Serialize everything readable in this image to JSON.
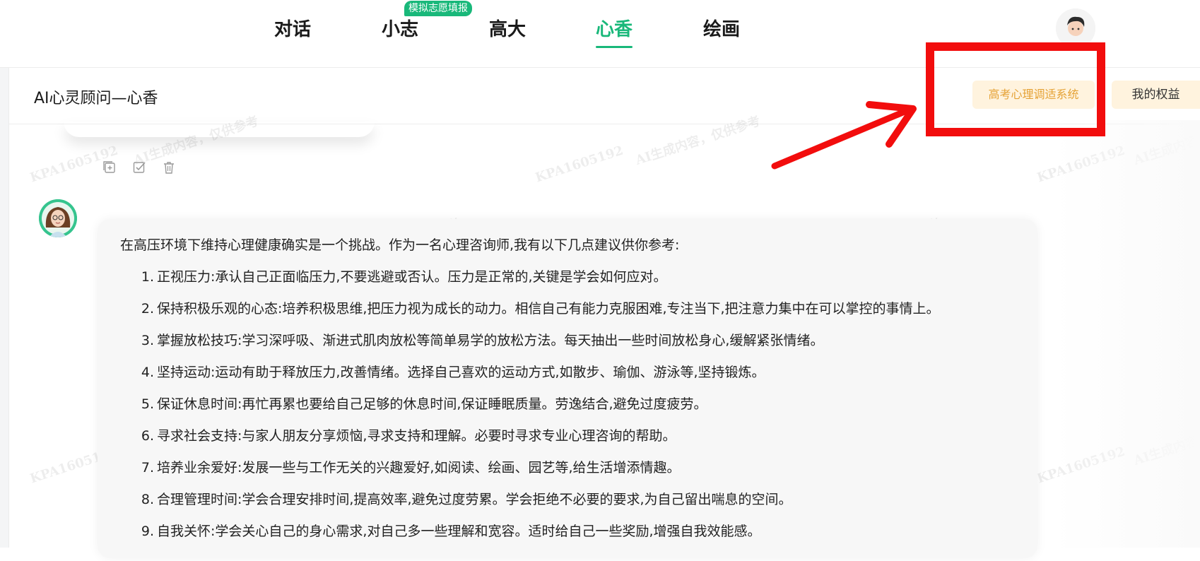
{
  "nav": {
    "tabs": [
      {
        "label": "对话",
        "active": false
      },
      {
        "label": "小志",
        "active": false
      },
      {
        "label": "高大",
        "active": false
      },
      {
        "label": "心香",
        "active": true
      },
      {
        "label": "绘画",
        "active": false
      }
    ],
    "badge": "模拟志愿填报",
    "accent_color": "#19b87a"
  },
  "header": {
    "title": "AI心灵顾问—心香",
    "psych_button": "高考心理调适系统",
    "rights_button": "我的权益"
  },
  "watermark": {
    "text_cn": "AI生成内容，仅供参考",
    "text_id": "KPA1605192"
  },
  "message": {
    "actions": [
      "add-icon",
      "checklist-icon",
      "trash-icon"
    ],
    "intro": "在高压环境下维持心理健康确实是一个挑战。作为一名心理咨询师,我有以下几点建议供你参考:",
    "items": [
      {
        "num": "1.",
        "text": "正视压力:承认自己正面临压力,不要逃避或否认。压力是正常的,关键是学会如何应对。"
      },
      {
        "num": "2.",
        "text": "保持积极乐观的心态:培养积极思维,把压力视为成长的动力。相信自己有能力克服困难,专注当下,把注意力集中在可以掌控的事情上。"
      },
      {
        "num": "3.",
        "text": "掌握放松技巧:学习深呼吸、渐进式肌肉放松等简单易学的放松方法。每天抽出一些时间放松身心,缓解紧张情绪。"
      },
      {
        "num": "4.",
        "text": "坚持运动:运动有助于释放压力,改善情绪。选择自己喜欢的运动方式,如散步、瑜伽、游泳等,坚持锻炼。"
      },
      {
        "num": "5.",
        "text": "保证休息时间:再忙再累也要给自己足够的休息时间,保证睡眠质量。劳逸结合,避免过度疲劳。"
      },
      {
        "num": "6.",
        "text": "寻求社会支持:与家人朋友分享烦恼,寻求支持和理解。必要时寻求专业心理咨询的帮助。"
      },
      {
        "num": "7.",
        "text": "培养业余爱好:发展一些与工作无关的兴趣爱好,如阅读、绘画、园艺等,给生活增添情趣。"
      },
      {
        "num": "8.",
        "text": "合理管理时间:学会合理安排时间,提高效率,避免过度劳累。学会拒绝不必要的要求,为自己留出喘息的空间。"
      },
      {
        "num": "9.",
        "text": "自我关怀:学会关心自己的身心需求,对自己多一些理解和宽容。适时给自己一些奖励,增强自我效能感。"
      }
    ]
  }
}
